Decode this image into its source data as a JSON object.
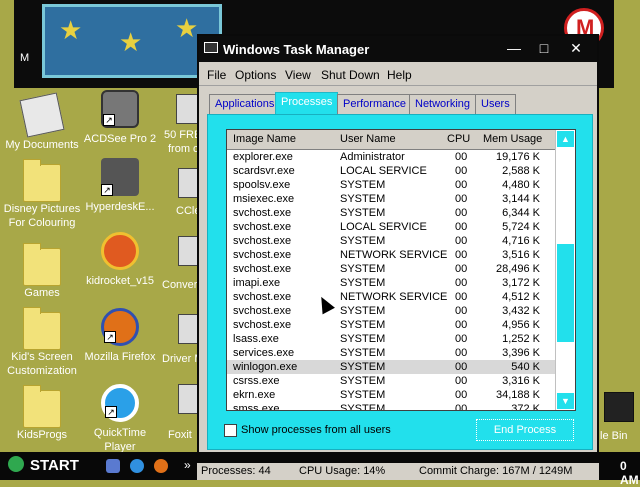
{
  "desktop": {
    "banner_label": "M",
    "icons": [
      {
        "label": "My Documents"
      },
      {
        "label": "ACDSee Pro 2"
      },
      {
        "label": "Disney Pictures For Colouring"
      },
      {
        "label": "HyperdeskE..."
      },
      {
        "label": "Games"
      },
      {
        "label": "kidrocket_v15"
      },
      {
        "label": "Kid's Screen Customization"
      },
      {
        "label": "Mozilla Firefox"
      },
      {
        "label": "KidsProgs"
      },
      {
        "label": "QuickTime Player"
      }
    ],
    "partial_labels": [
      "50 FRE",
      "from c",
      "CCle",
      "Conver",
      "Driver M",
      "Foxit",
      "le Bin"
    ]
  },
  "window": {
    "title": "Windows Task Manager",
    "controls": {
      "minimize": "—",
      "maximize": "□",
      "close": "✕"
    },
    "menu": [
      "File",
      "Options",
      "View",
      "Shut Down",
      "Help"
    ],
    "tabs": [
      {
        "label": "Applications",
        "active": false
      },
      {
        "label": "Processes",
        "active": true
      },
      {
        "label": "Performance",
        "active": false
      },
      {
        "label": "Networking",
        "active": false
      },
      {
        "label": "Users",
        "active": false
      }
    ],
    "columns": {
      "name": "Image Name",
      "user": "User Name",
      "cpu": "CPU",
      "mem": "Mem Usage"
    },
    "processes": [
      {
        "name": "explorer.exe",
        "user": "Administrator",
        "cpu": "00",
        "mem": "19,176 K"
      },
      {
        "name": "scardsvr.exe",
        "user": "LOCAL SERVICE",
        "cpu": "00",
        "mem": "2,588 K"
      },
      {
        "name": "spoolsv.exe",
        "user": "SYSTEM",
        "cpu": "00",
        "mem": "4,480 K"
      },
      {
        "name": "msiexec.exe",
        "user": "SYSTEM",
        "cpu": "00",
        "mem": "3,144 K"
      },
      {
        "name": "svchost.exe",
        "user": "SYSTEM",
        "cpu": "00",
        "mem": "6,344 K"
      },
      {
        "name": "svchost.exe",
        "user": "LOCAL SERVICE",
        "cpu": "00",
        "mem": "5,724 K"
      },
      {
        "name": "svchost.exe",
        "user": "SYSTEM",
        "cpu": "00",
        "mem": "4,716 K"
      },
      {
        "name": "svchost.exe",
        "user": "NETWORK SERVICE",
        "cpu": "00",
        "mem": "3,516 K"
      },
      {
        "name": "svchost.exe",
        "user": "SYSTEM",
        "cpu": "00",
        "mem": "28,496 K"
      },
      {
        "name": "imapi.exe",
        "user": "SYSTEM",
        "cpu": "00",
        "mem": "3,172 K"
      },
      {
        "name": "svchost.exe",
        "user": "NETWORK SERVICE",
        "cpu": "00",
        "mem": "4,512 K"
      },
      {
        "name": "svchost.exe",
        "user": "SYSTEM",
        "cpu": "00",
        "mem": "3,432 K"
      },
      {
        "name": "svchost.exe",
        "user": "SYSTEM",
        "cpu": "00",
        "mem": "4,956 K"
      },
      {
        "name": "lsass.exe",
        "user": "SYSTEM",
        "cpu": "00",
        "mem": "1,252 K"
      },
      {
        "name": "services.exe",
        "user": "SYSTEM",
        "cpu": "00",
        "mem": "3,396 K"
      },
      {
        "name": "winlogon.exe",
        "user": "SYSTEM",
        "cpu": "00",
        "mem": "540 K",
        "selected": true
      },
      {
        "name": "csrss.exe",
        "user": "SYSTEM",
        "cpu": "00",
        "mem": "3,316 K"
      },
      {
        "name": "ekrn.exe",
        "user": "SYSTEM",
        "cpu": "00",
        "mem": "34,188 K"
      },
      {
        "name": "smss.exe",
        "user": "SYSTEM",
        "cpu": "00",
        "mem": "372 K"
      }
    ],
    "show_all_label": "Show processes from all users",
    "show_all_checked": false,
    "end_process_label": "End Process"
  },
  "statusbar": {
    "processes": "Processes: 44",
    "cpu": "CPU Usage: 14%",
    "commit": "Commit Charge: 167M / 1249M"
  },
  "taskbar": {
    "start_label": "START",
    "clock": "0 AM",
    "chevron": "»"
  },
  "colors": {
    "desktop": "#a8a848",
    "accent": "#22e0ec",
    "titlebar": "#0c0c0c",
    "window": "#d4d0c8"
  }
}
